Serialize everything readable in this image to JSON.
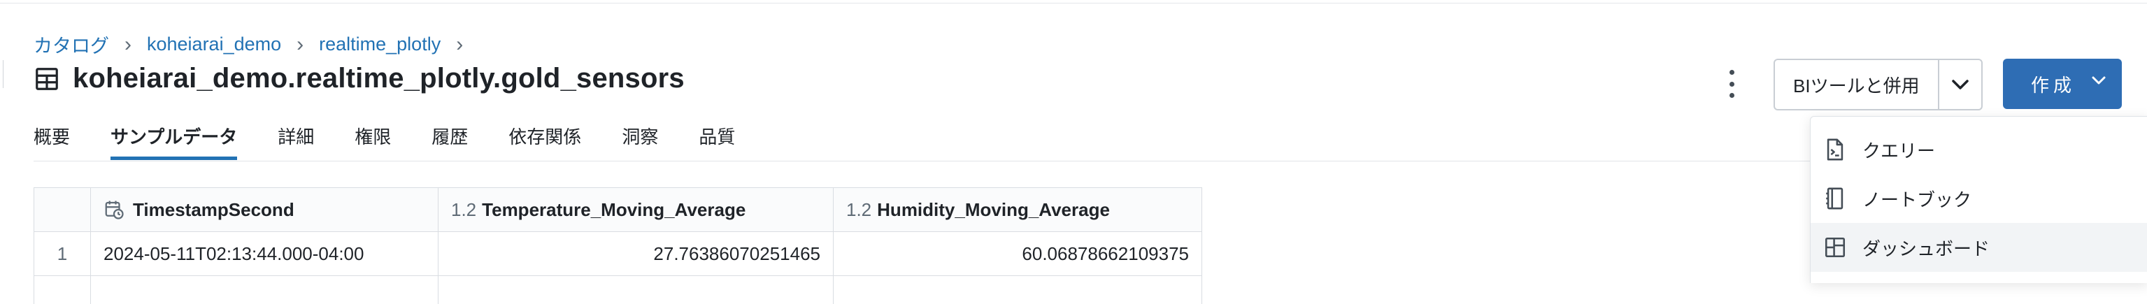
{
  "breadcrumb": {
    "items": [
      "カタログ",
      "koheiarai_demo",
      "realtime_plotly"
    ],
    "separator": "›"
  },
  "page": {
    "title": "koheiarai_demo.realtime_plotly.gold_sensors",
    "icon": "table-icon"
  },
  "tabs": [
    {
      "label": "概要"
    },
    {
      "label": "サンプルデータ",
      "active": true
    },
    {
      "label": "詳細"
    },
    {
      "label": "権限"
    },
    {
      "label": "履歴"
    },
    {
      "label": "依存関係"
    },
    {
      "label": "洞察"
    },
    {
      "label": "品質"
    }
  ],
  "actions": {
    "bi_button_label": "BIツールと併用",
    "create_button_label": "作成",
    "accent_color": "#2e6db4"
  },
  "table": {
    "columns": [
      {
        "type_label": "",
        "type_icon": "calendar-clock-icon",
        "name": "TimestampSecond"
      },
      {
        "type_label": "1.2",
        "name": "Temperature_Moving_Average"
      },
      {
        "type_label": "1.2",
        "name": "Humidity_Moving_Average"
      }
    ],
    "rows": [
      {
        "index": "1",
        "cells": [
          "2024-05-11T02:13:44.000-04:00",
          "27.76386070251465",
          "60.06878662109375"
        ]
      }
    ]
  },
  "dropdown": {
    "items": [
      {
        "label": "クエリー",
        "icon": "query-icon"
      },
      {
        "label": "ノートブック",
        "icon": "notebook-icon"
      },
      {
        "label": "ダッシュボード",
        "icon": "dashboard-icon",
        "highlighted": true
      }
    ]
  }
}
